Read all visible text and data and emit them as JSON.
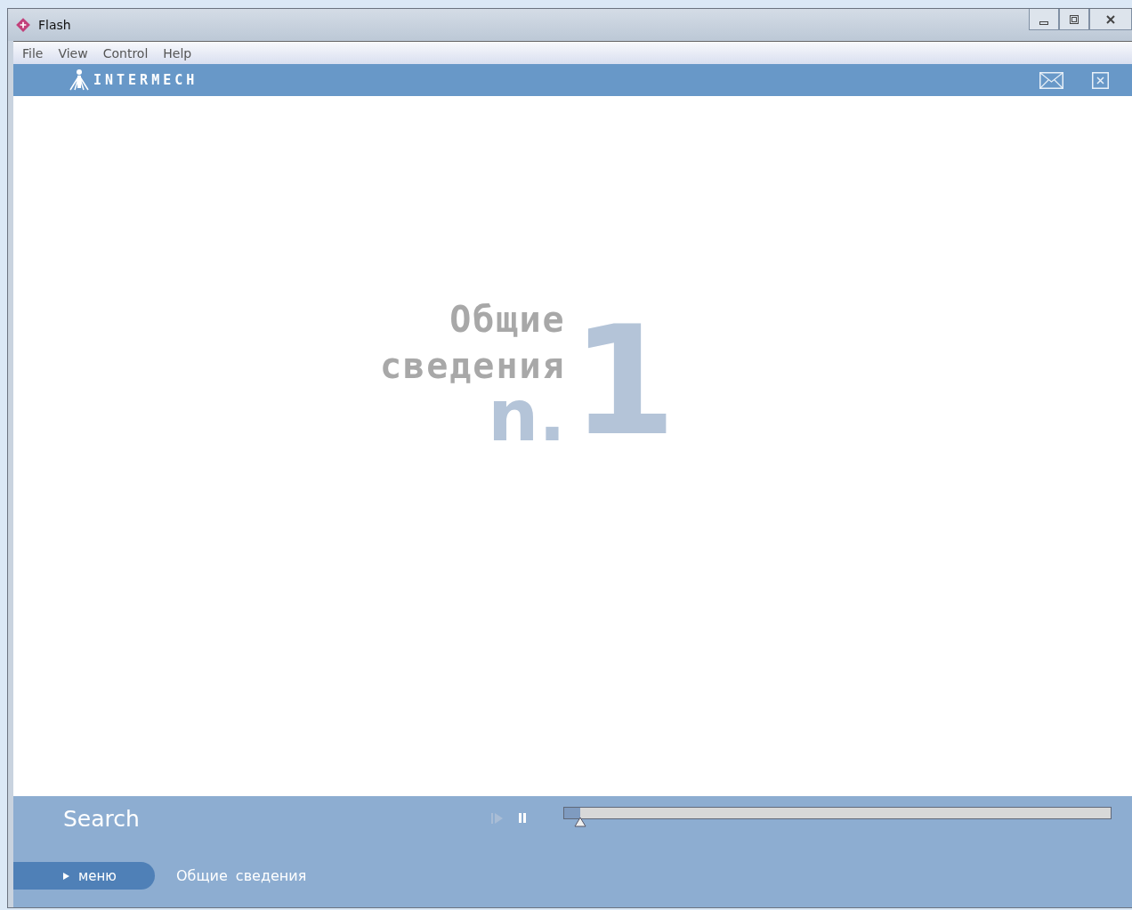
{
  "window": {
    "title": "Flash"
  },
  "menu": [
    "File",
    "View",
    "Control",
    "Help"
  ],
  "header": {
    "logo": "INTERMECH"
  },
  "slide": {
    "title_lines": [
      "Общие",
      "сведения"
    ],
    "prefix": "n.",
    "number": "1"
  },
  "footer": {
    "search": "Search",
    "player": {
      "playing": false,
      "level": 0.03
    },
    "menu_button": "меню",
    "breadcrumb": "Общие сведения"
  }
}
